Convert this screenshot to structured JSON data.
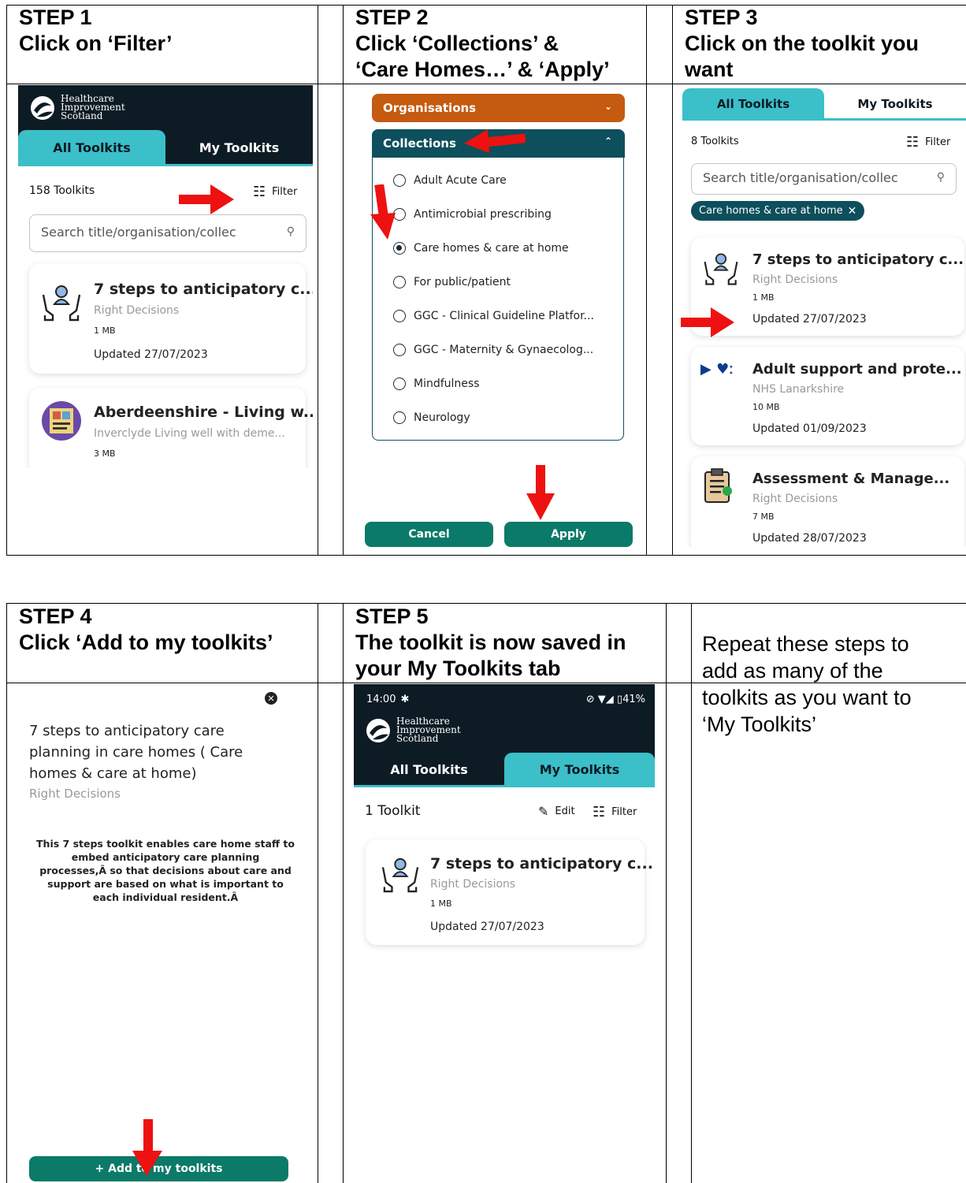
{
  "steps": {
    "s1": {
      "line1": "STEP 1",
      "line2": "Click on ‘Filter’"
    },
    "s2": {
      "line1": "STEP 2",
      "line2": "Click ‘Collections’ &",
      "line3": "‘Care Homes…’ & ‘Apply’"
    },
    "s3": {
      "line1": "STEP 3",
      "line2": "Click on the toolkit you",
      "line3": "want"
    },
    "s4": {
      "line1": "STEP 4",
      "line2": "Click ‘Add to my toolkits’"
    },
    "s5": {
      "line1": "STEP 5",
      "line2": "The toolkit is now saved in",
      "line3": "your My Toolkits tab"
    }
  },
  "repeat_note": {
    "l1": "Repeat these steps to",
    "l2": "add as many of the",
    "l3": "toolkits as you want to",
    "l4": "‘My Toolkits’"
  },
  "logo": {
    "l1": "Healthcare",
    "l2": "Improvement",
    "l3": "Scotland"
  },
  "tabs": {
    "all": "All Toolkits",
    "mine": "My Toolkits"
  },
  "filter_label": "Filter",
  "edit_label": "Edit",
  "search_placeholder": "Search title/organisation/collec",
  "screen1": {
    "count": "158 Toolkits",
    "cards": [
      {
        "title": "7 steps to anticipatory c...",
        "org": "Right Decisions",
        "size": "1 MB",
        "updated": "Updated 27/07/2023",
        "icon": "care-hands-icon"
      },
      {
        "title": "Aberdeenshire - Living w...",
        "org": "Inverclyde Living well with deme...",
        "size": "3 MB",
        "icon": "book-thumbnail-icon"
      }
    ]
  },
  "screen2": {
    "organisations": "Organisations",
    "collections": "Collections",
    "options": [
      "Adult Acute Care",
      "Antimicrobial prescribing",
      "Care homes & care at home",
      "For public/patient",
      "GGC - Clinical Guideline Platfor...",
      "GGC - Maternity & Gynaecolog...",
      "Mindfulness",
      "Neurology"
    ],
    "selected": "Care homes & care at home",
    "cancel": "Cancel",
    "apply": "Apply",
    "colors": {
      "organisations": "#c55a11",
      "collections": "#0d4f5c"
    }
  },
  "screen3": {
    "count": "8 Toolkits",
    "chip": "Care homes & care at home",
    "cards": [
      {
        "title": "7 steps to anticipatory c...",
        "org": "Right Decisions",
        "size": "1 MB",
        "updated": "Updated 27/07/2023",
        "icon": "care-hands-icon"
      },
      {
        "title": "Adult support and prote...",
        "org": "NHS Lanarkshire",
        "size": "10 MB",
        "updated": "Updated 01/09/2023",
        "icon": "nhs-logo-icon"
      },
      {
        "title": "Assessment & Manage...",
        "org": "Right Decisions",
        "size": "7 MB",
        "updated": "Updated 28/07/2023",
        "icon": "clipboard-icon"
      }
    ]
  },
  "screen4": {
    "title": "7 steps to anticipatory care planning in care homes ( Care homes & care at home)",
    "title_l1": "7 steps to anticipatory care",
    "title_l2": "planning in care homes ( Care",
    "title_l3": "homes & care at home)",
    "org": "Right Decisions",
    "desc_l1": "This 7 steps toolkit enables care home staff to",
    "desc_l2": "embed anticipatory care planning",
    "desc_l3": "processes,Â  so that decisions about care and",
    "desc_l4": "support are based on what is important to",
    "desc_l5": "each individual resident.Â",
    "add_button": "+ Add to my toolkits"
  },
  "screen5": {
    "time": "14:00",
    "battery": "41%",
    "count": "1 Toolkit",
    "card": {
      "title": "7 steps to anticipatory c...",
      "org": "Right Decisions",
      "size": "1 MB",
      "updated": "Updated 27/07/2023"
    }
  },
  "colors": {
    "teal_tab": "#3bbfc9",
    "dark_header": "#0d1b24",
    "green_button": "#0b7a68",
    "chip": "#0d4f5c",
    "arrow": "#ee1111"
  }
}
